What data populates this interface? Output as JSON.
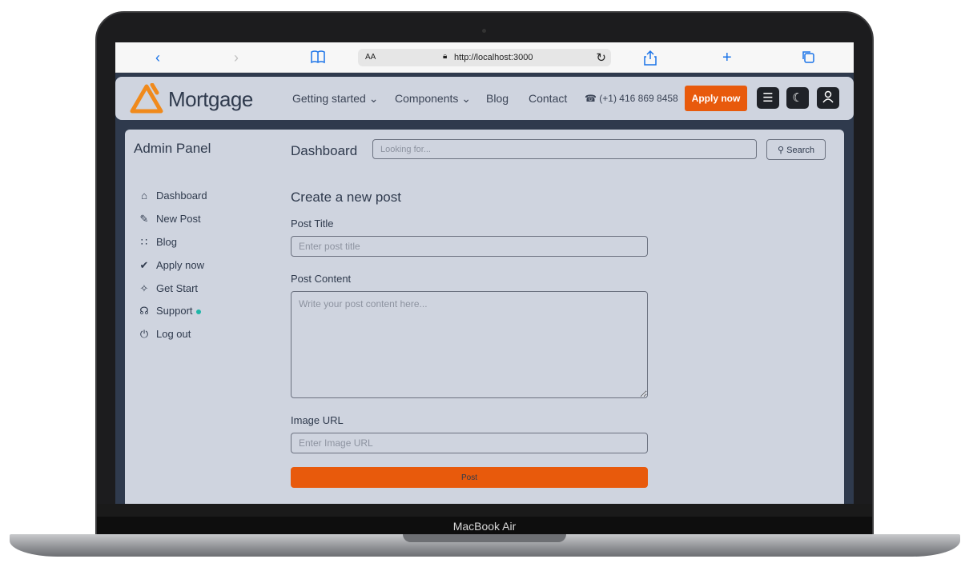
{
  "device": {
    "label": "MacBook Air"
  },
  "browser": {
    "text_size": "AA",
    "url": "http://localhost:3000",
    "icons": [
      "back-icon",
      "forward-icon",
      "bookmarks-icon",
      "lock-icon",
      "reload-icon",
      "share-icon",
      "new-tab-icon",
      "tabs-icon"
    ]
  },
  "nav": {
    "logo_text": "Mortgage",
    "links": [
      "Getting started ⌄",
      "Components ⌄",
      "Blog",
      "Contact"
    ],
    "phone": "(+1) 416 869 8458",
    "apply_label": "Apply now",
    "accent": "#e85a0c"
  },
  "sidebar": {
    "title": "Admin Panel",
    "items": [
      {
        "label": "Dashboard",
        "icon": "home-icon"
      },
      {
        "label": "New Post",
        "icon": "edit-icon"
      },
      {
        "label": "Blog",
        "icon": "rss-icon"
      },
      {
        "label": "Apply now",
        "icon": "check-circle-icon"
      },
      {
        "label": "Get Start",
        "icon": "sparkles-icon"
      },
      {
        "label": "Support",
        "icon": "headset-icon"
      },
      {
        "label": "Log out",
        "icon": "power-icon"
      }
    ]
  },
  "header": {
    "title": "Dashboard",
    "search_placeholder": "Looking for...",
    "search_label": "Search"
  },
  "form": {
    "title": "Create a new post",
    "post_title_label": "Post Title",
    "post_title_placeholder": "Enter post title",
    "content_label": "Post Content",
    "content_placeholder": "Write your post content here...",
    "image_label": "Image URL",
    "image_placeholder": "Enter Image URL",
    "submit_label": "Post"
  }
}
